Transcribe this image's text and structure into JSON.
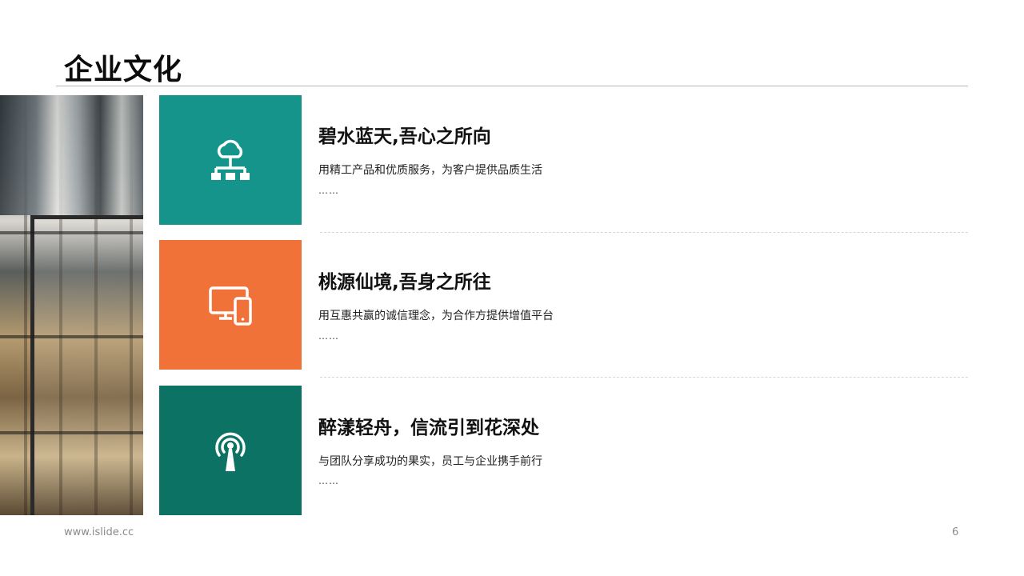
{
  "page": {
    "title": "企业文化",
    "footer_url": "www.islide.cc",
    "page_number": "6"
  },
  "colors": {
    "teal": "#14948a",
    "orange": "#f07238",
    "dark_green": "#0b7264"
  },
  "items": [
    {
      "title": "碧水蓝天,吾心之所向",
      "desc": "用精工产品和优质服务，为客户提供品质生活",
      "ellipsis": "……",
      "icon": "cloud-network-icon",
      "color": "#14948a"
    },
    {
      "title": "桃源仙境,吾身之所往",
      "desc": "用互惠共赢的诚信理念，为合作方提供增值平台",
      "ellipsis": "……",
      "icon": "devices-icon",
      "color": "#f07238"
    },
    {
      "title": "醉漾轻舟，信流引到花深处",
      "desc": "与团队分享成功的果实，员工与企业携手前行",
      "ellipsis": "……",
      "icon": "broadcast-tower-icon",
      "color": "#0b7264"
    }
  ]
}
